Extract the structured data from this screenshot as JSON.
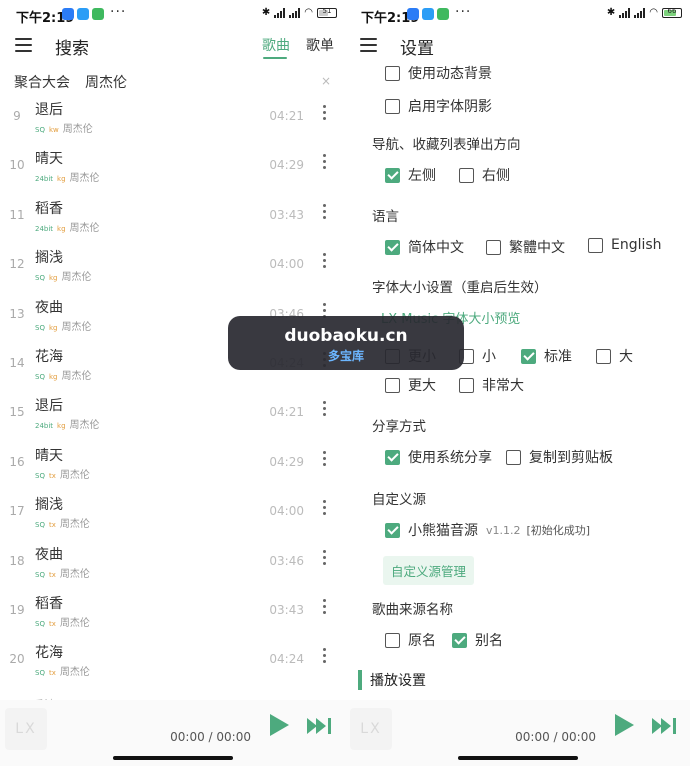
{
  "status": {
    "time": "下午2:19",
    "more": "···",
    "battery": "51",
    "battery_right": "66"
  },
  "search_screen": {
    "title": "搜索",
    "tabs": [
      "歌曲",
      "歌单"
    ],
    "source": "聚合大会",
    "keyword": "周杰伦",
    "clear": "×",
    "songs": [
      {
        "num": "9",
        "name": "退后",
        "q": "SQ",
        "src": "kw",
        "artist": "周杰伦",
        "duration": "04:21"
      },
      {
        "num": "10",
        "name": "晴天",
        "q": "24bit",
        "src": "kg",
        "artist": "周杰伦",
        "duration": "04:29"
      },
      {
        "num": "11",
        "name": "稻香",
        "q": "24bit",
        "src": "kg",
        "artist": "周杰伦",
        "duration": "03:43"
      },
      {
        "num": "12",
        "name": "搁浅",
        "q": "SQ",
        "src": "kg",
        "artist": "周杰伦",
        "duration": "04:00"
      },
      {
        "num": "13",
        "name": "夜曲",
        "q": "SQ",
        "src": "kg",
        "artist": "周杰伦",
        "duration": "03:46"
      },
      {
        "num": "14",
        "name": "花海",
        "q": "SQ",
        "src": "kg",
        "artist": "周杰伦",
        "duration": "04:24"
      },
      {
        "num": "15",
        "name": "退后",
        "q": "24bit",
        "src": "kg",
        "artist": "周杰伦",
        "duration": "04:21"
      },
      {
        "num": "16",
        "name": "晴天",
        "q": "SQ",
        "src": "tx",
        "artist": "周杰伦",
        "duration": "04:29"
      },
      {
        "num": "17",
        "name": "搁浅",
        "q": "SQ",
        "src": "tx",
        "artist": "周杰伦",
        "duration": "04:00"
      },
      {
        "num": "18",
        "name": "夜曲",
        "q": "SQ",
        "src": "tx",
        "artist": "周杰伦",
        "duration": "03:46"
      },
      {
        "num": "19",
        "name": "稻香",
        "q": "SQ",
        "src": "tx",
        "artist": "周杰伦",
        "duration": "03:43"
      },
      {
        "num": "20",
        "name": "花海",
        "q": "SQ",
        "src": "tx",
        "artist": "周杰伦",
        "duration": "04:24"
      }
    ],
    "partial_song": "彩虹"
  },
  "player": {
    "logo": "LX",
    "time": "00:00 / 00:00"
  },
  "settings_screen": {
    "title": "设置",
    "dynamic_bg": "使用动态背景",
    "font_shadow": "启用字体阴影",
    "nav_direction_title": "导航、收藏列表弹出方向",
    "nav_left": "左侧",
    "nav_right": "右侧",
    "language_title": "语言",
    "lang_zh_cn": "简体中文",
    "lang_zh_tw": "繁體中文",
    "lang_en": "English",
    "font_size_title": "字体大小设置（重启后生效）",
    "font_preview": "LX Music 字体大小预览",
    "size_smaller": "更小",
    "size_small": "小",
    "size_standard": "标准",
    "size_large": "大",
    "size_larger": "更大",
    "size_huge": "非常大",
    "share_title": "分享方式",
    "share_system": "使用系统分享",
    "share_clipboard": "复制到剪贴板",
    "custom_source_title": "自定义源",
    "custom_source_name": "小熊猫音源",
    "custom_source_version": "v1.1.2",
    "custom_source_status": "[初始化成功]",
    "custom_source_manage": "自定义源管理",
    "song_source_name_title": "歌曲来源名称",
    "name_original": "原名",
    "name_alias": "别名",
    "playback_section": "播放设置"
  },
  "watermark": {
    "main": "duobaoku.cn",
    "sub": "多宝库"
  },
  "colors": {
    "accent": "#4daa7e",
    "tag_source": "#e39e3f"
  }
}
